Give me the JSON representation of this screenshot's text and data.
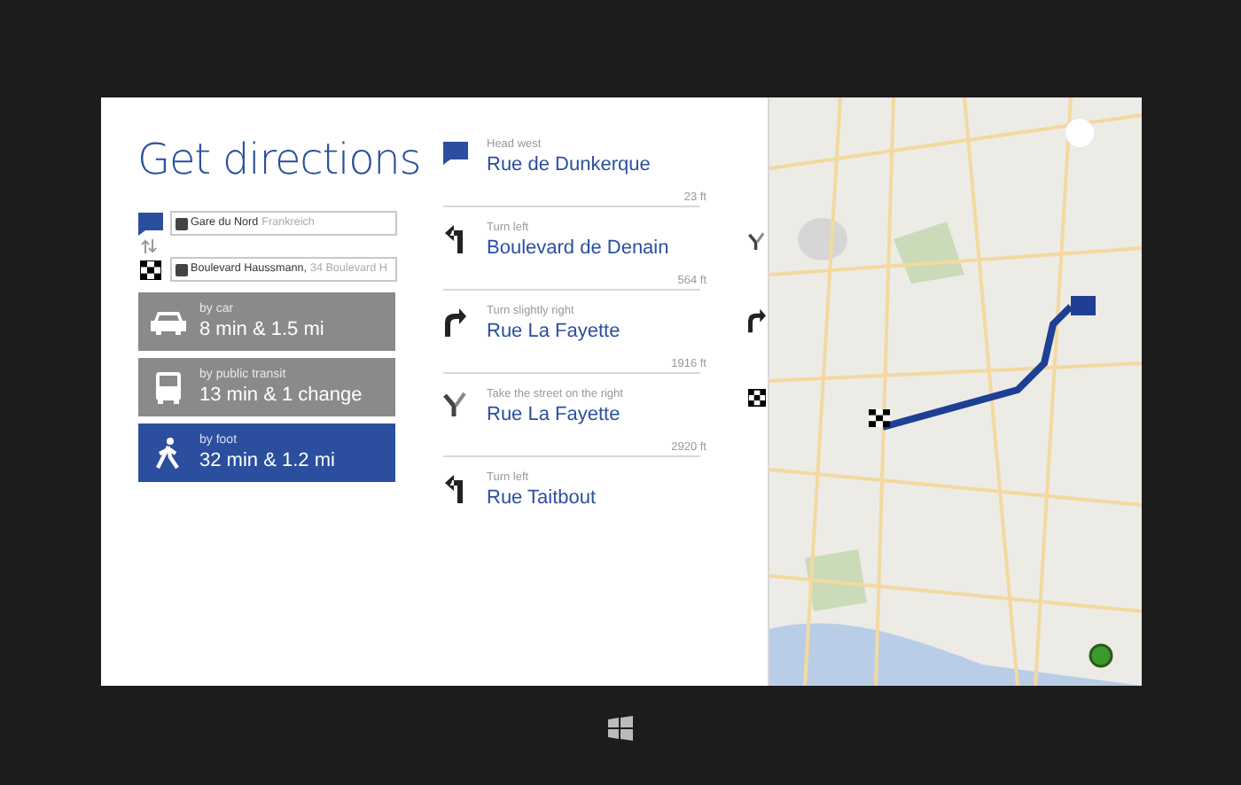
{
  "title": "Get directions",
  "route_fields": [
    {
      "kind": "start",
      "value": "Gare du Nord",
      "detail": "Frankreich"
    },
    {
      "kind": "finish",
      "value": "Boulevard Haussmann,",
      "detail": "34 Boulevard H"
    }
  ],
  "travel_modes": [
    {
      "kind": "car",
      "label": "by car",
      "value": "8 min & 1.5 mi",
      "selected": false
    },
    {
      "kind": "transit",
      "label": "by public transit",
      "value": "13 min & 1 change",
      "selected": false
    },
    {
      "kind": "foot",
      "label": "by foot",
      "value": "32 min & 1.2 mi",
      "selected": true
    }
  ],
  "steps": [
    {
      "kind": "start",
      "instruction": "Head west",
      "street": "Rue de Dunkerque",
      "distance": "23 ft"
    },
    {
      "kind": "left",
      "instruction": "Turn left",
      "street": "Boulevard de Denain",
      "distance": "564 ft"
    },
    {
      "kind": "right",
      "instruction": "Turn slightly right",
      "street": "Rue La Fayette",
      "distance": "1916 ft"
    },
    {
      "kind": "fork",
      "instruction": "Take the street on the right",
      "street": "Rue La Fayette",
      "distance": "2920 ft"
    },
    {
      "kind": "left",
      "instruction": "Turn left",
      "street": "Rue Taitbout"
    }
  ],
  "next_column": [
    {
      "kind": "fork"
    },
    {
      "kind": "right"
    },
    {
      "kind": "finish"
    }
  ]
}
